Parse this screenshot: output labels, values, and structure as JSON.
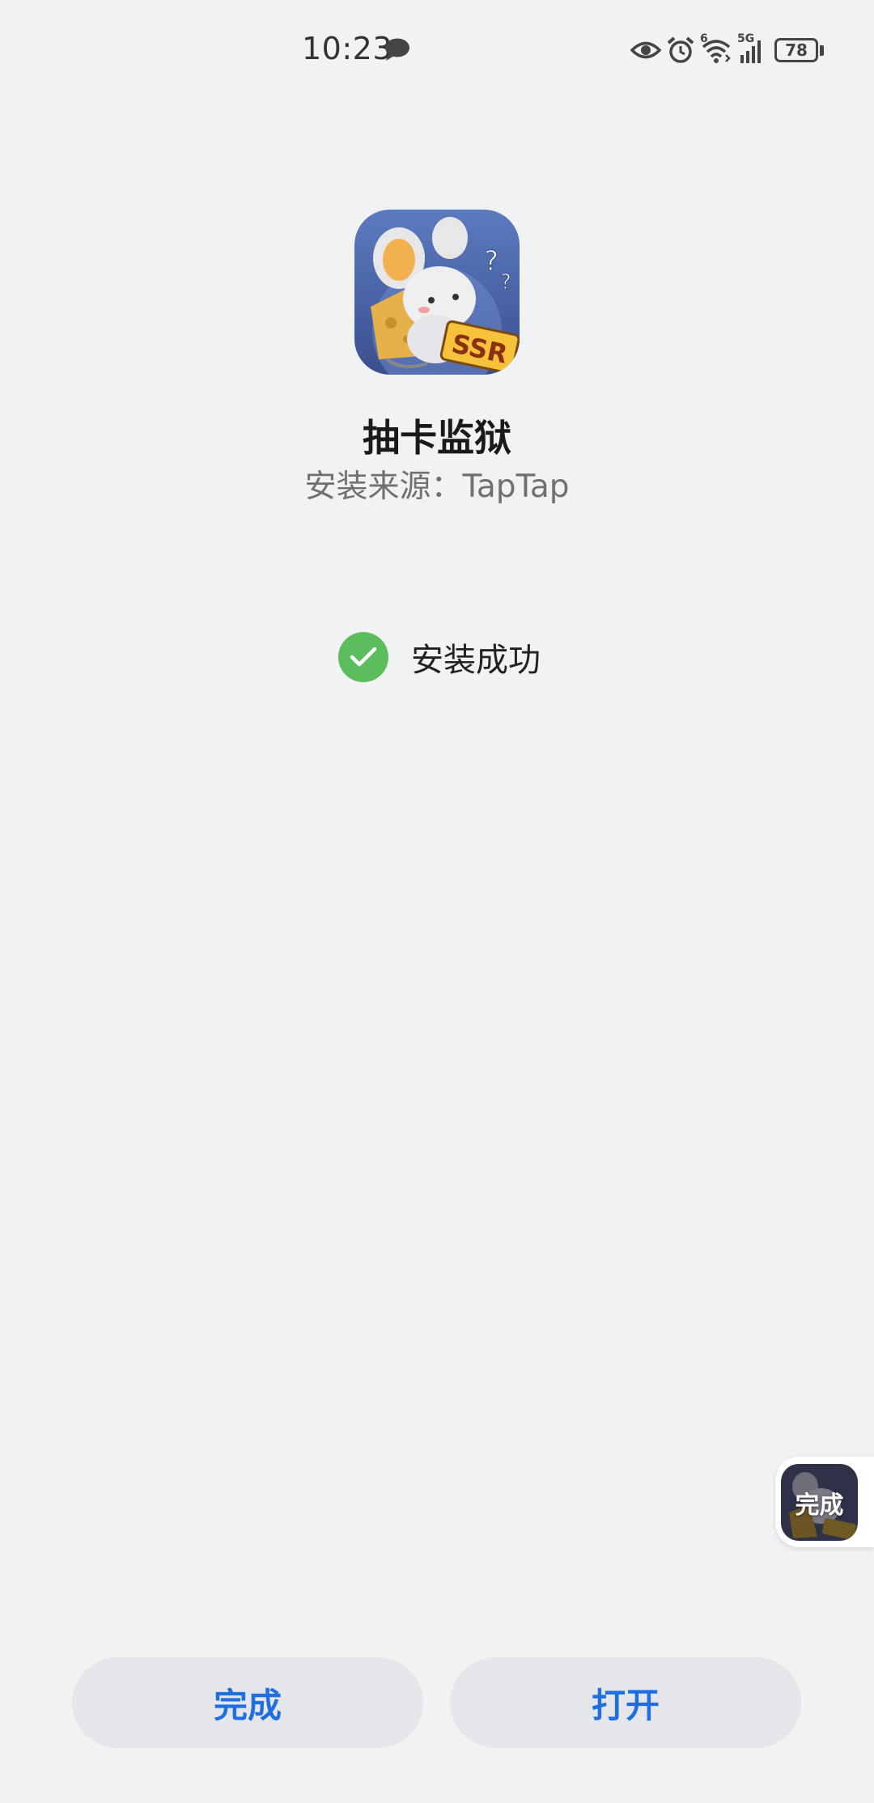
{
  "status_bar": {
    "time": "10:23",
    "battery_level": "78",
    "network_labels": {
      "wifi_tag": "6",
      "cellular_tag": "5G"
    },
    "icons": [
      "message-icon",
      "eye-icon",
      "alarm-icon",
      "wifi-icon",
      "signal-icon",
      "battery-icon"
    ]
  },
  "app": {
    "name": "抽卡监狱",
    "source": "安装来源：TapTap",
    "icon_badge": "SSR"
  },
  "result": {
    "text": "安装成功",
    "color": "#5cbd5c"
  },
  "floating_widget": {
    "label": "完成"
  },
  "buttons": {
    "done_label": "完成",
    "open_label": "打开",
    "accent_color": "#1f6fe0"
  }
}
